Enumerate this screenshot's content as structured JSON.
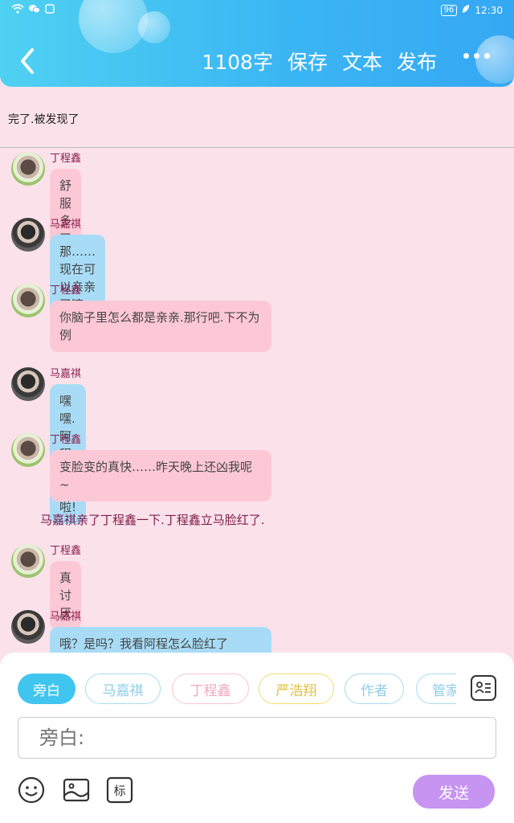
{
  "status_bar": {
    "battery": "96",
    "time": "12:30"
  },
  "header": {
    "word_count": "1108字",
    "save": "保存",
    "text": "文本",
    "publish": "发布"
  },
  "story_title": "完了.被发现了",
  "messages": [
    {
      "speaker": "丁程鑫",
      "text": "舒服多了~",
      "side": "pink"
    },
    {
      "speaker": "马嘉祺",
      "text": "那……现在可以亲亲了嘛~",
      "side": "blue"
    },
    {
      "speaker": "丁程鑫",
      "text": "你脑子里怎么都是亲亲.那行吧.下不为例",
      "side": "pink"
    },
    {
      "speaker": "马嘉祺",
      "text": "嘿嘿.阿程最好啦!",
      "side": "blue"
    },
    {
      "speaker": "丁程鑫",
      "text": "变脸变的真快……昨天晚上还凶我呢 ~",
      "side": "pink"
    },
    {
      "speaker": "丁程鑫",
      "text": "真讨厌",
      "side": "pink"
    },
    {
      "speaker": "马嘉祺",
      "text": "哦？是吗？我看阿程怎么脸红了",
      "side": "blue"
    }
  ],
  "narration": "马嘉祺亲了丁程鑫一下.丁程鑫立马脸红了.",
  "characters": [
    "旁白",
    "马嘉祺",
    "丁程鑫",
    "严浩翔",
    "作者",
    "管家"
  ],
  "input": {
    "placeholder": "旁白:"
  },
  "send_label": "发送",
  "tools": {
    "tag_label": "标"
  }
}
